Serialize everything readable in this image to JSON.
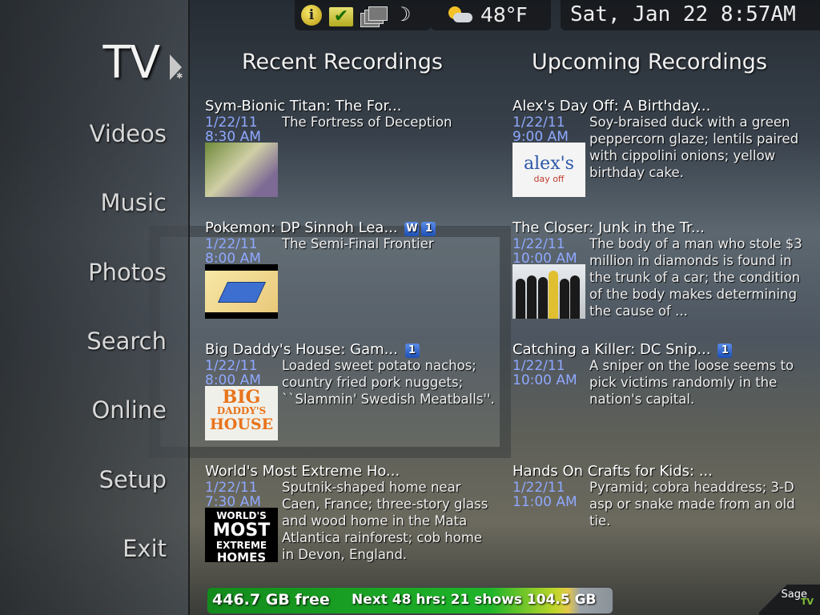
{
  "sidebar": {
    "title": "TV",
    "items": [
      {
        "label": "Videos"
      },
      {
        "label": "Music"
      },
      {
        "label": "Photos"
      },
      {
        "label": "Search"
      },
      {
        "label": "Online"
      },
      {
        "label": "Setup"
      },
      {
        "label": "Exit"
      }
    ]
  },
  "topbar": {
    "icons": [
      "info-icon",
      "checkmark-icon",
      "windows-icon",
      "moon-icon"
    ],
    "weather_icon": "partly-sunny-icon",
    "temperature": "48°F",
    "datetime": "Sat, Jan 22 8:57AM"
  },
  "recent": {
    "header": "Recent Recordings",
    "items": [
      {
        "title": "Sym-Bionic Titan: The For...",
        "badges": [],
        "date": "1/22/11",
        "time": "8:30 AM",
        "description": "The Fortress of Deception"
      },
      {
        "title": "Pokemon: DP Sinnoh Lea...",
        "badges": [
          "W",
          "1"
        ],
        "date": "1/22/11",
        "time": "8:00 AM",
        "description": "The Semi-Final Frontier"
      },
      {
        "title": "Big Daddy's House: Gam...",
        "badges": [
          "1"
        ],
        "date": "1/22/11",
        "time": "8:00 AM",
        "description": "Loaded sweet potato nachos; country fried pork nuggets; ``Slammin' Swedish Meatballs''."
      },
      {
        "title": "World's Most Extreme Ho...",
        "badges": [],
        "date": "1/22/11",
        "time": "7:30 AM",
        "description": "Sputnik-shaped home near Caen, France; three-story glass and wood home in the Mata Atlantica rainforest; cob home in Devon, England."
      }
    ]
  },
  "upcoming": {
    "header": "Upcoming Recordings",
    "items": [
      {
        "title": "Alex's Day Off: A Birthday...",
        "badges": [],
        "date": "1/22/11",
        "time": "9:00 AM",
        "description": "Soy-braised duck with a green peppercorn glaze; lentils paired with cippolini onions; yellow birthday cake."
      },
      {
        "title": "The Closer: Junk in the Tr...",
        "badges": [],
        "date": "1/22/11",
        "time": "10:00 AM",
        "description": "The body of a man who stole $3 million in diamonds is found in the trunk of a car; the condition of the body makes determining the cause of ..."
      },
      {
        "title": "Catching a Killer: DC Snip...",
        "badges": [
          "1"
        ],
        "date": "1/22/11",
        "time": "10:00 AM",
        "description": "A sniper on the loose seems to pick victims randomly in the nation's capital."
      },
      {
        "title": "Hands On Crafts for Kids: ...",
        "badges": [],
        "date": "1/22/11",
        "time": "11:00 AM",
        "description": "Pyramid; cobra headdress; 3-D asp or snake made from an old tie."
      }
    ]
  },
  "thumbnails": {
    "big_daddy": [
      "BIG",
      "DADDY'S",
      "HOUSE"
    ],
    "world_most": [
      "WORLD'S",
      "MOST",
      "EXTREME",
      "HOMES"
    ],
    "alex": [
      "alex's",
      "day off"
    ]
  },
  "storage": {
    "free": "446.7 GB free",
    "next": "Next 48 hrs: 21 shows 104.5 GB",
    "used_fraction": 0.89
  },
  "logo": {
    "text": "Sage",
    "suffix": "TV"
  }
}
